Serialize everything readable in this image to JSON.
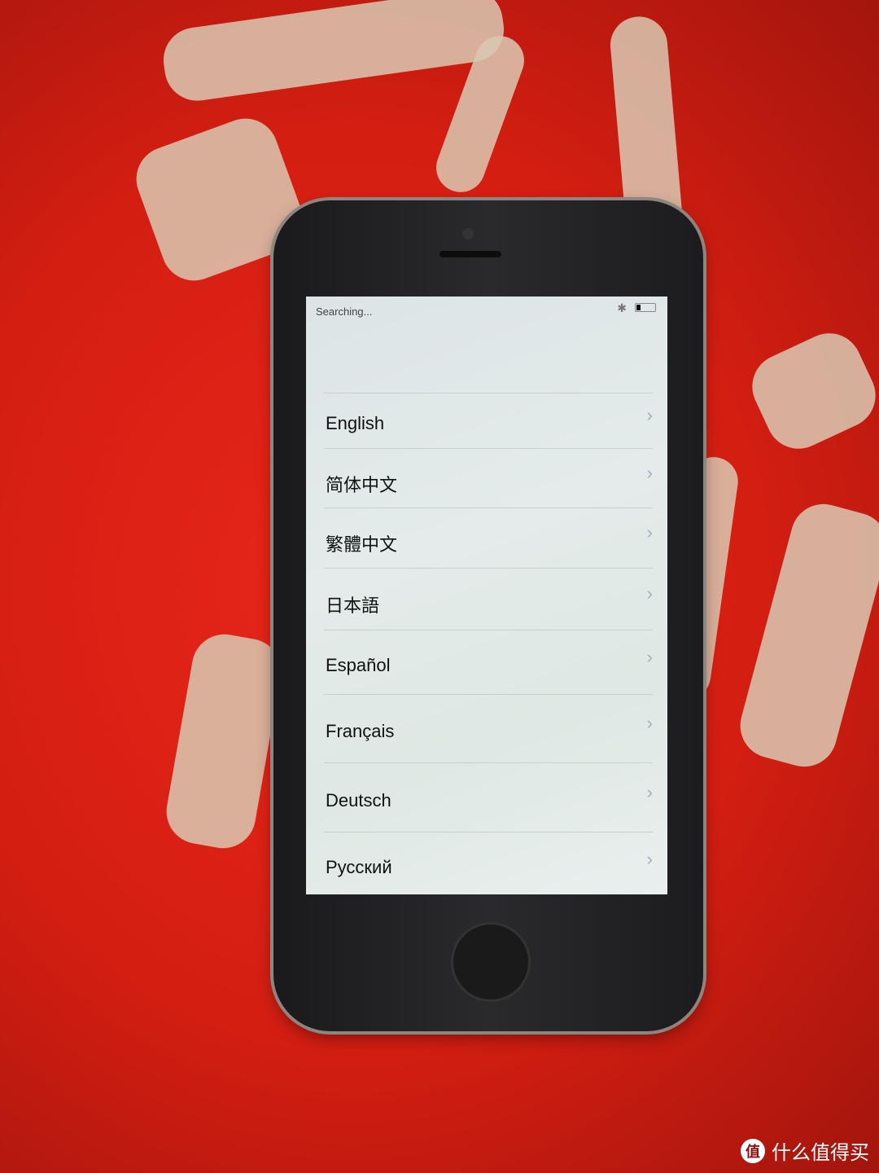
{
  "status_bar": {
    "carrier_text": "Searching...",
    "bluetooth_icon": "bluetooth-icon",
    "battery_level_percent": 10
  },
  "languages": [
    {
      "label": "English"
    },
    {
      "label": "简体中文"
    },
    {
      "label": "繁體中文"
    },
    {
      "label": "日本語"
    },
    {
      "label": "Español"
    },
    {
      "label": "Français"
    },
    {
      "label": "Deutsch"
    },
    {
      "label": "Русский"
    }
  ],
  "chevron": "›",
  "watermark": {
    "logo_char": "值",
    "text": "什么值得买"
  },
  "colors": {
    "background": "#d41e12",
    "phone_body": "#1f1f21",
    "screen": "#e2e9e8"
  }
}
